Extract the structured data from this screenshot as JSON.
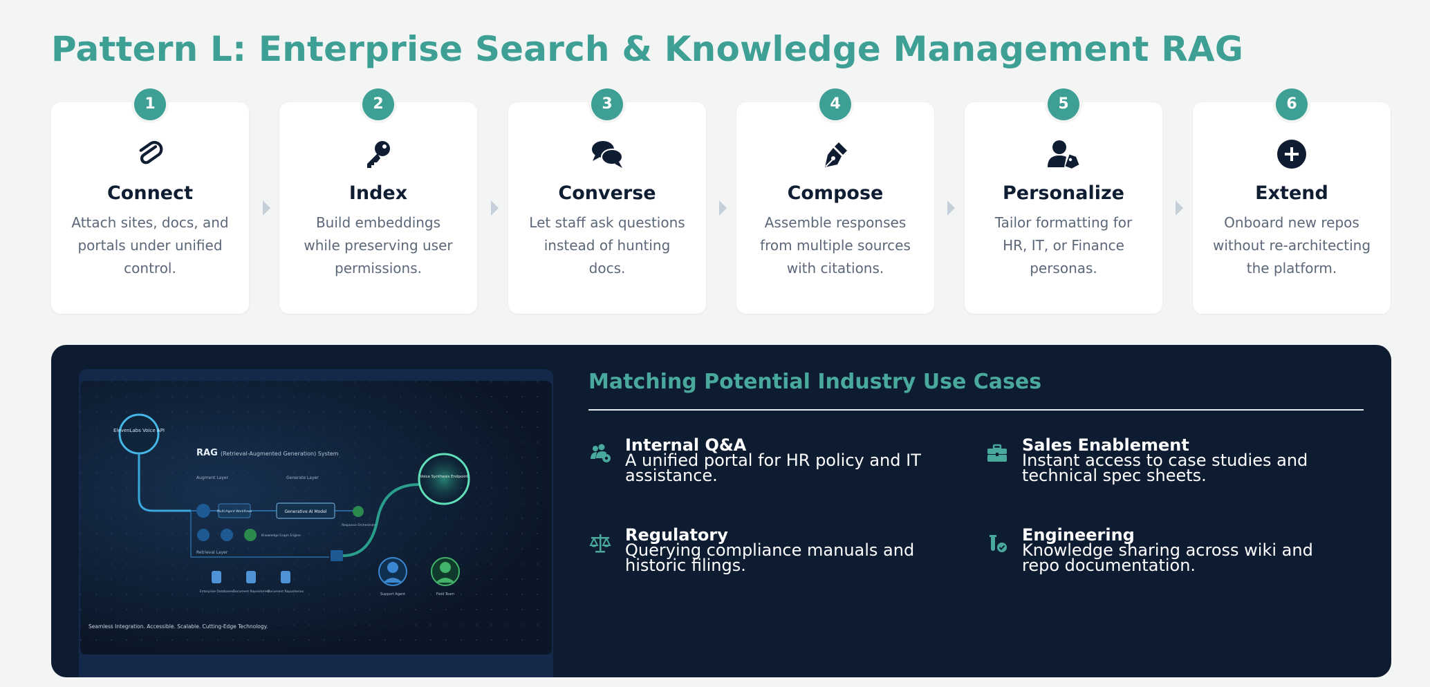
{
  "page": {
    "title": "Pattern L: Enterprise Search & Knowledge Management RAG"
  },
  "steps": [
    {
      "number": "1",
      "icon": "paperclip-icon",
      "title": "Connect",
      "description": "Attach sites, docs, and portals under unified control."
    },
    {
      "number": "2",
      "icon": "key-icon",
      "title": "Index",
      "description": "Build embeddings while preserving user permissions."
    },
    {
      "number": "3",
      "icon": "chat-bubbles-icon",
      "title": "Converse",
      "description": "Let staff ask questions instead of hunting docs."
    },
    {
      "number": "4",
      "icon": "pen-nib-icon",
      "title": "Compose",
      "description": "Assemble responses from multiple sources with citations."
    },
    {
      "number": "5",
      "icon": "user-tag-icon",
      "title": "Personalize",
      "description": "Tailor formatting for HR, IT, or Finance personas."
    },
    {
      "number": "6",
      "icon": "plus-circle-icon",
      "title": "Extend",
      "description": "Onboard new repos without re-architecting the platform."
    }
  ],
  "use_cases": {
    "heading": "Matching Potential Industry Use Cases",
    "items": [
      {
        "icon": "users-gear-icon",
        "name": "Internal Q&A",
        "description": " A unified portal for HR policy and IT assistance."
      },
      {
        "icon": "briefcase-icon",
        "name": "Sales Enablement",
        "description": " Instant access to case studies and technical spec sheets."
      },
      {
        "icon": "scale-balance-icon",
        "name": "Regulatory",
        "description": " Querying compliance manuals and historic filings."
      },
      {
        "icon": "vial-check-icon",
        "name": "Engineering",
        "description": " Knowledge sharing across wiki and repo documentation."
      }
    ]
  },
  "diagram_image": {
    "heading": "RAG",
    "subheading": "(Retrieval-Augmented Generation) System",
    "voice_api": "ElevenLabs Voice API",
    "augment_layer": "Augment Layer",
    "generate_layer": "Generate Layer",
    "retrieval_layer": "Retrieval Layer",
    "multi_agent": "Multi-Agent Workflows",
    "generative_model": "Generative AI Model",
    "knowledge_graph": "Knowledge Graph Engine",
    "response_orchestrator": "Response Orchestrator",
    "voice_synthesis": "Voice Synthesis Endpoint",
    "db1": "Enterprise Databases",
    "db2": "Document Repositories",
    "db3": "Document Repositories",
    "support_agent": "Support Agent",
    "field_team": "Field Team",
    "caption": "Seamless Integration. Accessible. Scalable. Cutting-Edge Technology."
  },
  "colors": {
    "accent": "#3e9f95",
    "panel": "#0e1c32",
    "card": "#ffffff",
    "heading_dark": "#0f1d33",
    "body_text": "#5b6778"
  }
}
